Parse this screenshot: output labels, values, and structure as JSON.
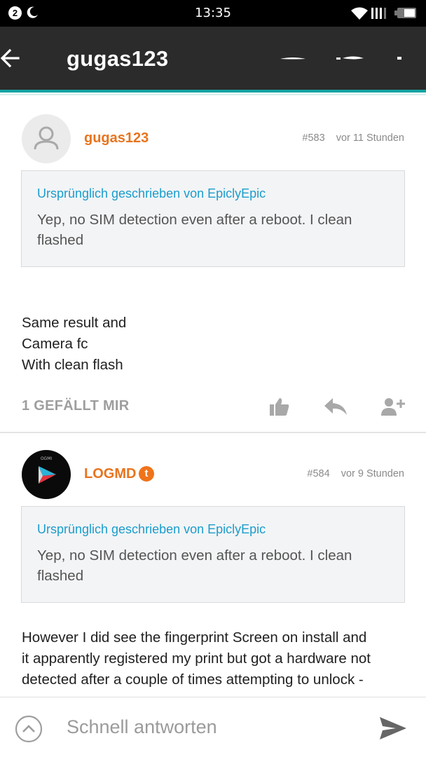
{
  "status_bar": {
    "notification_count": "2",
    "time": "13:35",
    "icons": [
      "moon-icon",
      "wifi-icon",
      "signal-icon",
      "battery-icon"
    ]
  },
  "app_bar": {
    "title": "gugas123",
    "icons": [
      "back-arrow-icon",
      "action-icon",
      "action-icon",
      "overflow-icon"
    ]
  },
  "posts": [
    {
      "username": "gugas123",
      "post_number": "#583",
      "time": "vor 11 Stunden",
      "avatar": "default-user-icon",
      "quote_header": "Ursprünglich geschrieben von EpiclyEpic",
      "quote_text": "Yep, no SIM detection even after a reboot. I clean flashed",
      "body_lines": [
        "Same result and",
        "Camera fc",
        "With clean flash"
      ],
      "likes_label": "1 GEFÄLLT MIR",
      "actions": [
        "thumbs-up-icon",
        "reply-icon",
        "add-user-icon"
      ]
    },
    {
      "username": "LOGMD",
      "badge": "t",
      "post_number": "#584",
      "time": "vor 9 Stunden",
      "avatar": "logmd-logo-avatar",
      "avatar_text": "OGMI",
      "quote_header": "Ursprünglich geschrieben von EpiclyEpic",
      "quote_text": "Yep, no SIM detection even after a reboot. I clean flashed",
      "body_lines": [
        "However I did see the fingerprint Screen on install and",
        "it apparently registered my print but got a hardware not",
        "detected after a couple of times attempting to unlock -"
      ]
    }
  ],
  "reply_bar": {
    "placeholder": "Schnell antworten",
    "icons": [
      "expand-up-icon",
      "send-icon"
    ]
  },
  "colors": {
    "accent": "#14a3a3",
    "username": "#e8741e",
    "quote_header": "#1a9dcc",
    "app_bar": "#2b2b2b"
  }
}
